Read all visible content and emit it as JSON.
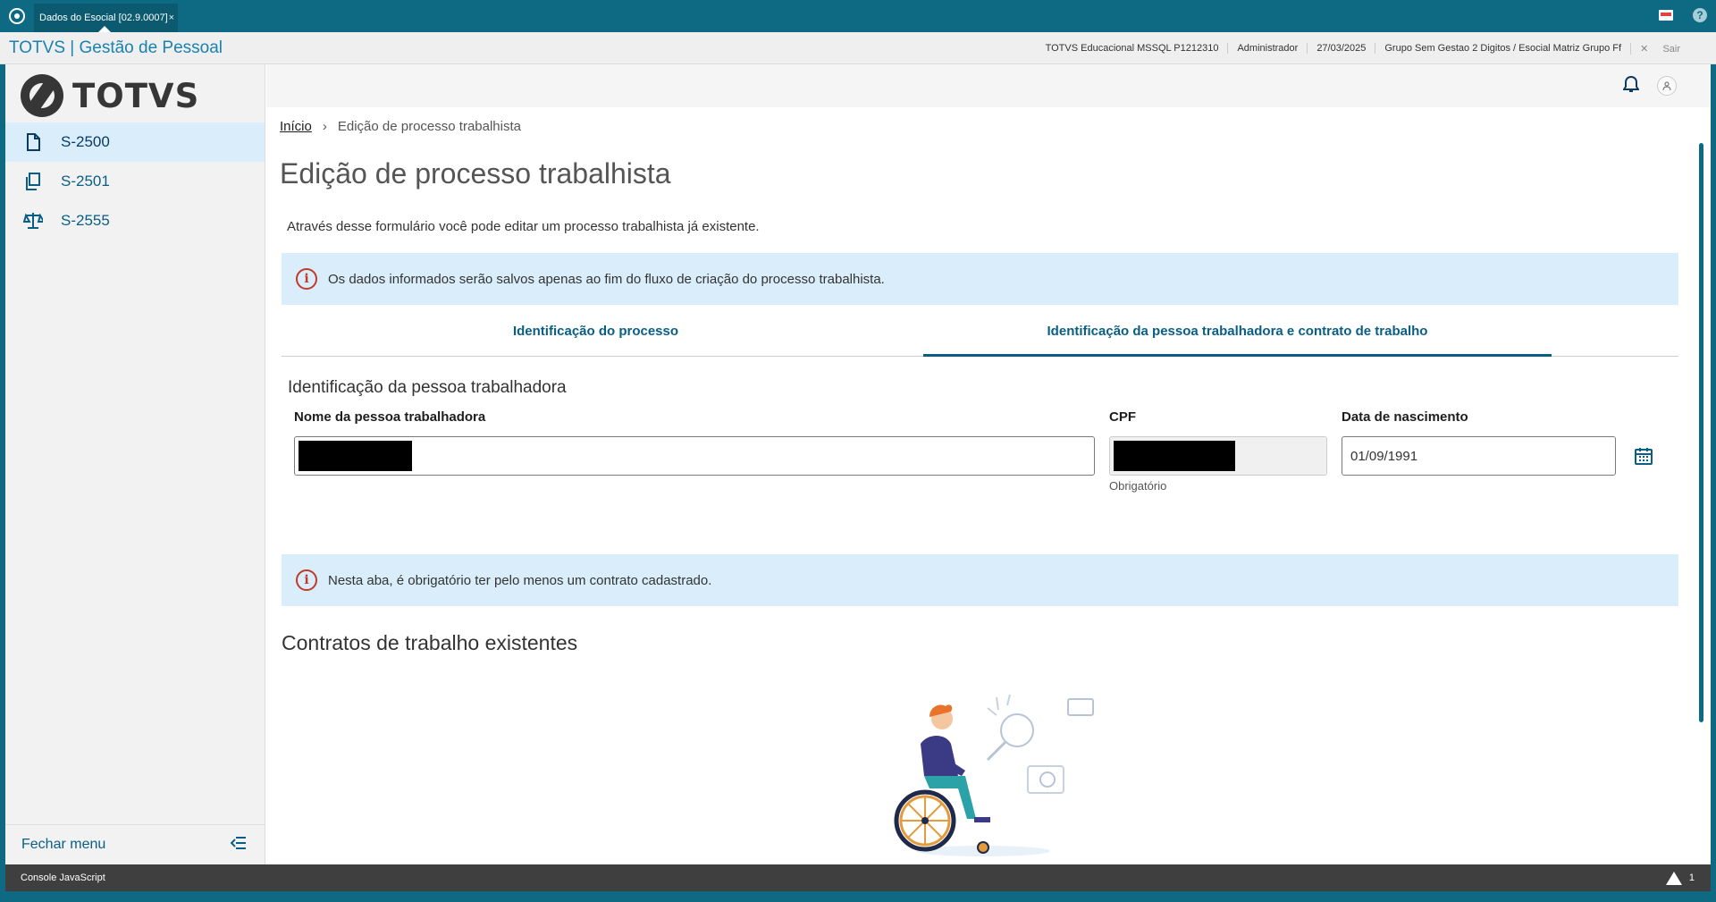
{
  "window": {
    "tab_title": "Dados do Esocial [02.9.0007]",
    "tab_close": "×"
  },
  "system": {
    "title": "TOTVS | Gestão de Pessoal",
    "environment": "TOTVS Educacional MSSQL P1212310",
    "user": "Administrador",
    "date": "27/03/2025",
    "group": "Grupo Sem Gestao 2 Digitos / Esocial Matriz Grupo Ff",
    "exit_label": "Sair"
  },
  "sidebar": {
    "brand": "TOTVS",
    "items": [
      {
        "label": "S-2500",
        "icon": "document-icon",
        "active": true
      },
      {
        "label": "S-2501",
        "icon": "documents-copy-icon",
        "active": false
      },
      {
        "label": "S-2555",
        "icon": "scale-icon",
        "active": false
      }
    ],
    "close_menu": "Fechar menu"
  },
  "breadcrumb": {
    "home": "Início",
    "current": "Edição de processo trabalhista"
  },
  "page": {
    "title": "Edição de processo trabalhista",
    "description": "Através desse formulário você pode editar um processo trabalhista já existente.",
    "alert_1": "Os dados informados serão salvos apenas ao fim do fluxo de criação do processo trabalhista.",
    "alert_2": "Nesta aba, é obrigatório ter pelo menos um contrato cadastrado."
  },
  "tabs": [
    {
      "label": "Identificação do processo",
      "active": false
    },
    {
      "label": "Identificação da pessoa trabalhadora e contrato de trabalho",
      "active": true
    }
  ],
  "worker": {
    "section_title": "Identificação da pessoa trabalhadora",
    "name_label": "Nome da pessoa trabalhadora",
    "cpf_label": "CPF",
    "cpf_helper": "Obrigatório",
    "birth_label": "Data de nascimento",
    "birth_value": "01/09/1991"
  },
  "contracts": {
    "title": "Contratos de trabalho existentes"
  },
  "console": {
    "label": "Console JavaScript",
    "warning_count": "1"
  },
  "colors": {
    "primary": "#0e6a83",
    "link": "#0a5e86",
    "alert_bg": "#d9eefa",
    "alert_icon": "#c0392b"
  }
}
